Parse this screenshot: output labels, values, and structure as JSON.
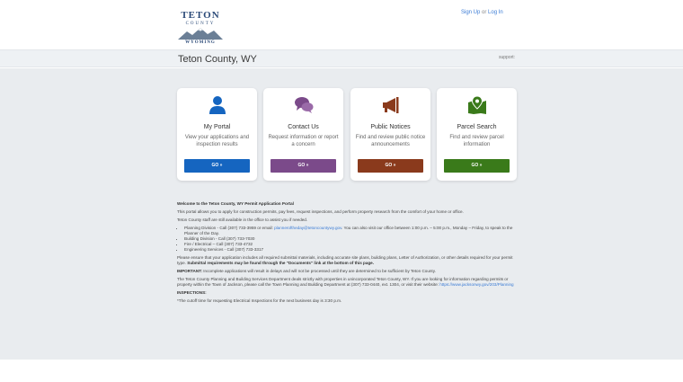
{
  "header": {
    "logo": {
      "top": "TETON",
      "middle": "COUNTY",
      "bottom": "WYOMING"
    },
    "auth": {
      "sign_up": "Sign Up",
      "or": "or",
      "log_in": "Log In"
    }
  },
  "titlebar": {
    "title": "Teton County, WY",
    "support": "support:"
  },
  "cards": [
    {
      "title": "My Portal",
      "description": "View your applications and inspection results",
      "button": "GO »",
      "color": "#1565c0",
      "icon": "user-icon"
    },
    {
      "title": "Contact Us",
      "description": "Request information or report a concern",
      "button": "GO »",
      "color": "#7b4a8a",
      "icon": "chat-bubbles-icon"
    },
    {
      "title": "Public Notices",
      "description": "Find and review public notice announcements",
      "button": "GO »",
      "color": "#8a3a1c",
      "icon": "megaphone-icon"
    },
    {
      "title": "Parcel Search",
      "description": "Find and review parcel information",
      "button": "GO »",
      "color": "#3a7a1a",
      "icon": "map-pin-icon"
    }
  ],
  "content": {
    "welcome": "Welcome to the Teton County, WY Permit Application Portal",
    "intro": "This portal allows you to apply for construction permits, pay fees, request inspections, and perform property research from the comfort of your home or office.",
    "staff": "Teton County staff are still available in the office to assist you if needed.",
    "contacts": [
      {
        "text": "Planning Division - Call (307) 733-3959 or email: ",
        "link": "planneroftheday@tetoncountywy.gov",
        "after": ". You can also visit our office between 1:00 p.m. – 5:00 p.m., Monday – Friday, to speak to the Planner of the Day."
      },
      {
        "text": "Building Division - Call (307) 733-7030",
        "link": "",
        "after": ""
      },
      {
        "text": "Fire / Electrical – Call (307) 733-4732",
        "link": "",
        "after": ""
      },
      {
        "text": "Engineering Services - Call (307) 733-3317",
        "link": "",
        "after": ""
      }
    ],
    "ensure_a": "Please ensure that your application includes all required submittal materials, including accurate site plans, building plans, Letter of Authorization, or other details required for your permit type. ",
    "ensure_b": "Submittal requirements may be found through the \"Documents\" link at the bottom of this page.",
    "important_label": "IMPORTANT:",
    "important": " Incomplete applications will result in delays and will not be processed until they are determined to be sufficient by Teton County.",
    "dept": "The Teton County Planning and Building Services Department deals strictly with properties in unincorporated Teton County, WY.  If you are looking for information regarding permits or property within the Town of Jackson, please call the Town Planning and Building Department at (307) 733-0440, ext. 1304, or visit their website: ",
    "dept_link": "https://www.jacksonwy.gov/203/Planning",
    "inspections": "INSPECTIONS:",
    "cutoff": "*The cutoff time for requesting Electrical Inspections for the next business day is 3:30 p.m."
  }
}
